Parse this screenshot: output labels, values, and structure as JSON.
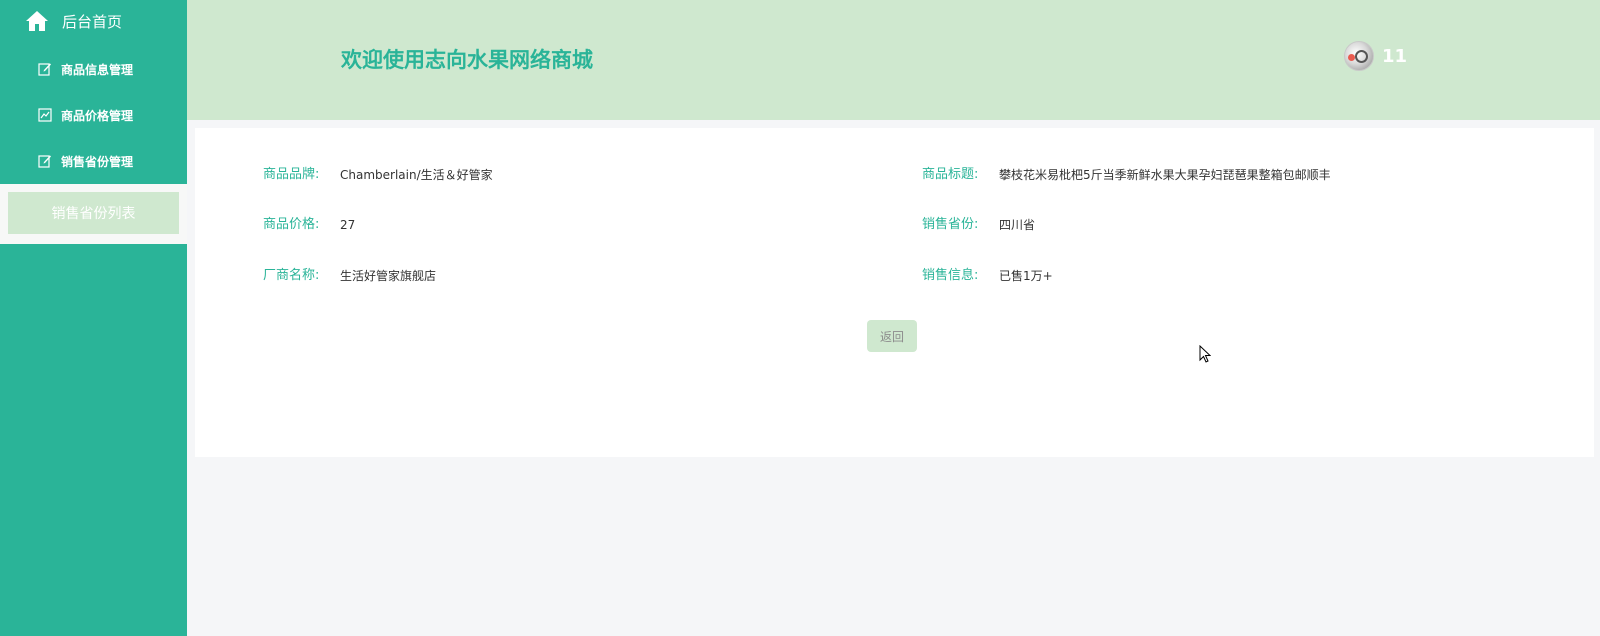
{
  "sidebar": {
    "home_label": "后台首页",
    "items": [
      {
        "label": "商品信息管理"
      },
      {
        "label": "商品价格管理"
      },
      {
        "label": "销售省份管理"
      }
    ],
    "sub_item_label": "销售省份列表"
  },
  "header": {
    "title": "欢迎使用志向水果网络商城",
    "username": "11"
  },
  "detail": {
    "brand_label": "商品品牌:",
    "brand_value": "Chamberlain/生活＆好管家",
    "title_label": "商品标题:",
    "title_value": "攀枝花米易枇杷5斤当季新鲜水果大果孕妇琵琶果整箱包邮顺丰",
    "price_label": "商品价格:",
    "price_value": "27",
    "province_label": "销售省份:",
    "province_value": "四川省",
    "maker_label": "厂商名称:",
    "maker_value": "生活好管家旗舰店",
    "sales_label": "销售信息:",
    "sales_value": "已售1万+",
    "back_label": "返回"
  },
  "colors": {
    "sidebar": "#2ab498",
    "header": "#cfe8cf",
    "accent": "#2ab498"
  }
}
